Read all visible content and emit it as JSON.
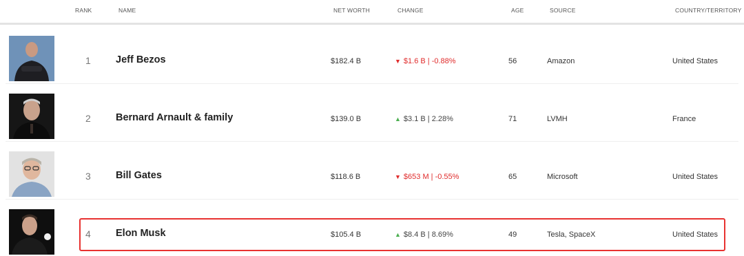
{
  "header": {
    "rank": "RANK",
    "name": "NAME",
    "net_worth": "NET WORTH",
    "change": "CHANGE",
    "age": "AGE",
    "source": "SOURCE",
    "country": "COUNTRY/TERRITORY"
  },
  "rows": [
    {
      "rank": "1",
      "name": "Jeff Bezos",
      "net_worth": "$182.4 B",
      "change": "$1.6 B | -0.88%",
      "change_direction": "down",
      "age": "56",
      "source": "Amazon",
      "country": "United States",
      "avatar_bg": "#6b8fb5"
    },
    {
      "rank": "2",
      "name": "Bernard Arnault & family",
      "net_worth": "$139.0 B",
      "change": "$3.1 B | 2.28%",
      "change_direction": "up",
      "age": "71",
      "source": "LVMH",
      "country": "France",
      "avatar_bg": "#1a1a1a"
    },
    {
      "rank": "3",
      "name": "Bill Gates",
      "net_worth": "$118.6 B",
      "change": "$653 M | -0.55%",
      "change_direction": "down",
      "age": "65",
      "source": "Microsoft",
      "country": "United States",
      "avatar_bg": "#d9d9d9"
    },
    {
      "rank": "4",
      "name": "Elon Musk",
      "net_worth": "$105.4 B",
      "change": "$8.4 B | 8.69%",
      "change_direction": "up",
      "age": "49",
      "source": "Tesla, SpaceX",
      "country": "United States",
      "avatar_bg": "#111111"
    }
  ],
  "colors": {
    "down": "#e02b2b",
    "up": "#4caf50",
    "highlight_border": "#e8312f"
  },
  "icons": {
    "up": "triangle-up-icon",
    "down": "triangle-down-icon"
  }
}
